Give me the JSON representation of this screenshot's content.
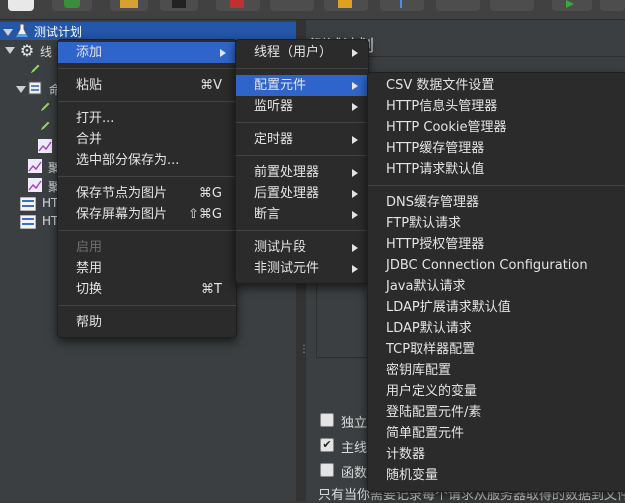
{
  "tree": {
    "root_label": "测试计划",
    "item_thread_group": "线",
    "item_group": "命",
    "item_listener1": "聚",
    "item_listener2": "聚",
    "item_http1": "HT",
    "item_http2": "HT"
  },
  "right_panel": {
    "title": "测试计划",
    "checkbox_labels": [
      "独立",
      "主线",
      "函数"
    ],
    "checkbox_states": [
      false,
      true,
      false
    ],
    "bottom_text": "只有当你需要记录每个请求从服务器取得的数据到文件"
  },
  "context_menu": {
    "items": [
      {
        "label": "添加",
        "shortcut": "",
        "submenu": true,
        "highlighted": true
      },
      {
        "label": "粘贴",
        "shortcut": "⌘V"
      },
      {
        "label": "打开...",
        "shortcut": ""
      },
      {
        "label": "合并",
        "shortcut": ""
      },
      {
        "label": "选中部分保存为...",
        "shortcut": ""
      },
      {
        "label": "保存节点为图片",
        "shortcut": "⌘G"
      },
      {
        "label": "保存屏幕为图片",
        "shortcut": "⇧⌘G"
      },
      {
        "label": "启用",
        "shortcut": "",
        "disabled": true
      },
      {
        "label": "禁用",
        "shortcut": ""
      },
      {
        "label": "切换",
        "shortcut": "⌘T"
      },
      {
        "label": "帮助",
        "shortcut": ""
      }
    ]
  },
  "add_submenu": {
    "items": [
      {
        "label": "线程（用户）"
      },
      {
        "label": "配置元件",
        "highlighted": true
      },
      {
        "label": "监听器"
      },
      {
        "label": "定时器"
      },
      {
        "label": "前置处理器"
      },
      {
        "label": "后置处理器"
      },
      {
        "label": "断言"
      },
      {
        "label": "测试片段"
      },
      {
        "label": "非测试元件"
      }
    ]
  },
  "config_submenu": {
    "items": [
      "CSV 数据文件设置",
      "HTTP信息头管理器",
      "HTTP Cookie管理器",
      "HTTP缓存管理器",
      "HTTP请求默认值",
      "DNS缓存管理器",
      "FTP默认请求",
      "HTTP授权管理器",
      "JDBC Connection Configuration",
      "Java默认请求",
      "LDAP扩展请求默认值",
      "LDAP默认请求",
      "TCP取样器配置",
      "密钥库配置",
      "用户定义的变量",
      "登陆配置元件/素",
      "简单配置元件",
      "计数器",
      "随机变量"
    ]
  },
  "colors": {
    "highlight": "#2f65ca",
    "selected_tree": "#2456a9",
    "menu_bg": "#2b2b2b"
  }
}
